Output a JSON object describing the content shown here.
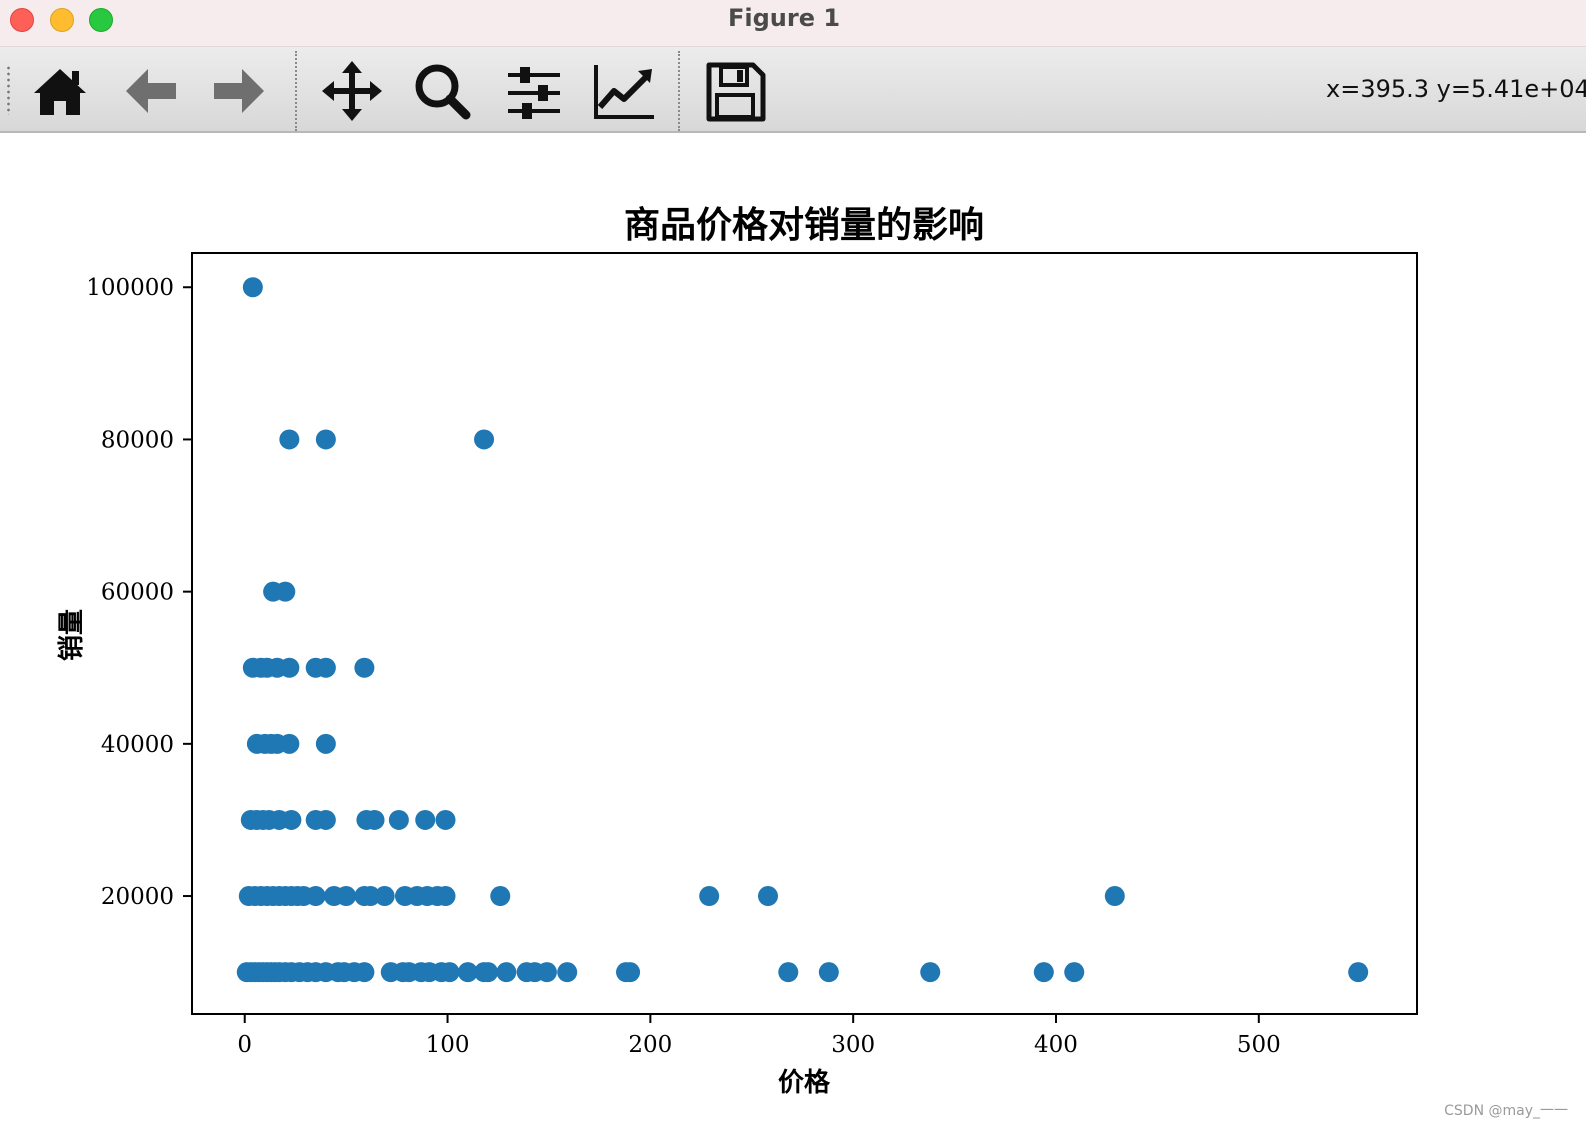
{
  "window": {
    "title": "Figure 1"
  },
  "toolbar": {
    "buttons": [
      {
        "name": "home-button",
        "icon": "home-icon"
      },
      {
        "name": "back-button",
        "icon": "arrow-left-icon"
      },
      {
        "name": "forward-button",
        "icon": "arrow-right-icon"
      },
      {
        "name": "pan-button",
        "icon": "move-icon"
      },
      {
        "name": "zoom-button",
        "icon": "magnifier-icon"
      },
      {
        "name": "subplots-button",
        "icon": "sliders-icon"
      },
      {
        "name": "edit-axes-button",
        "icon": "line-chart-icon"
      },
      {
        "name": "save-button",
        "icon": "floppy-disk-icon"
      }
    ],
    "coords": "x=395.3 y=5.41e+04"
  },
  "chart_data": {
    "type": "scatter",
    "title": "商品价格对销量的影响",
    "xlabel": "价格",
    "ylabel": "销量",
    "xlim": [
      -26,
      578
    ],
    "ylim": [
      4500,
      104500
    ],
    "xticks": [
      0,
      100,
      200,
      300,
      400,
      500
    ],
    "yticks": [
      20000,
      40000,
      60000,
      80000,
      100000
    ],
    "grid": false,
    "marker_color": "#1f77b4",
    "points": [
      [
        4,
        100000
      ],
      [
        22,
        80000
      ],
      [
        40,
        80000
      ],
      [
        118,
        80000
      ],
      [
        14,
        60000
      ],
      [
        20,
        60000
      ],
      [
        4,
        50000
      ],
      [
        8,
        50000
      ],
      [
        11,
        50000
      ],
      [
        16,
        50000
      ],
      [
        22,
        50000
      ],
      [
        35,
        50000
      ],
      [
        40,
        50000
      ],
      [
        59,
        50000
      ],
      [
        6,
        40000
      ],
      [
        10,
        40000
      ],
      [
        13,
        40000
      ],
      [
        16,
        40000
      ],
      [
        22,
        40000
      ],
      [
        40,
        40000
      ],
      [
        3,
        30000
      ],
      [
        6,
        30000
      ],
      [
        9,
        30000
      ],
      [
        12,
        30000
      ],
      [
        17,
        30000
      ],
      [
        23,
        30000
      ],
      [
        35,
        30000
      ],
      [
        40,
        30000
      ],
      [
        60,
        30000
      ],
      [
        64,
        30000
      ],
      [
        76,
        30000
      ],
      [
        89,
        30000
      ],
      [
        99,
        30000
      ],
      [
        2,
        20000
      ],
      [
        5,
        20000
      ],
      [
        8,
        20000
      ],
      [
        11,
        20000
      ],
      [
        14,
        20000
      ],
      [
        17,
        20000
      ],
      [
        20,
        20000
      ],
      [
        23,
        20000
      ],
      [
        26,
        20000
      ],
      [
        29,
        20000
      ],
      [
        35,
        20000
      ],
      [
        44,
        20000
      ],
      [
        50,
        20000
      ],
      [
        59,
        20000
      ],
      [
        62,
        20000
      ],
      [
        69,
        20000
      ],
      [
        79,
        20000
      ],
      [
        85,
        20000
      ],
      [
        90,
        20000
      ],
      [
        95,
        20000
      ],
      [
        99,
        20000
      ],
      [
        126,
        20000
      ],
      [
        229,
        20000
      ],
      [
        258,
        20000
      ],
      [
        429,
        20000
      ],
      [
        1,
        10000
      ],
      [
        3,
        10000
      ],
      [
        5,
        10000
      ],
      [
        7,
        10000
      ],
      [
        9,
        10000
      ],
      [
        11,
        10000
      ],
      [
        13,
        10000
      ],
      [
        15,
        10000
      ],
      [
        17,
        10000
      ],
      [
        20,
        10000
      ],
      [
        23,
        10000
      ],
      [
        27,
        10000
      ],
      [
        31,
        10000
      ],
      [
        35,
        10000
      ],
      [
        40,
        10000
      ],
      [
        46,
        10000
      ],
      [
        49,
        10000
      ],
      [
        54,
        10000
      ],
      [
        59,
        10000
      ],
      [
        72,
        10000
      ],
      [
        78,
        10000
      ],
      [
        81,
        10000
      ],
      [
        87,
        10000
      ],
      [
        91,
        10000
      ],
      [
        97,
        10000
      ],
      [
        101,
        10000
      ],
      [
        110,
        10000
      ],
      [
        118,
        10000
      ],
      [
        120,
        10000
      ],
      [
        129,
        10000
      ],
      [
        139,
        10000
      ],
      [
        143,
        10000
      ],
      [
        149,
        10000
      ],
      [
        159,
        10000
      ],
      [
        188,
        10000
      ],
      [
        190,
        10000
      ],
      [
        268,
        10000
      ],
      [
        288,
        10000
      ],
      [
        338,
        10000
      ],
      [
        394,
        10000
      ],
      [
        409,
        10000
      ],
      [
        549,
        10000
      ]
    ]
  },
  "watermark": "CSDN @may_一一"
}
